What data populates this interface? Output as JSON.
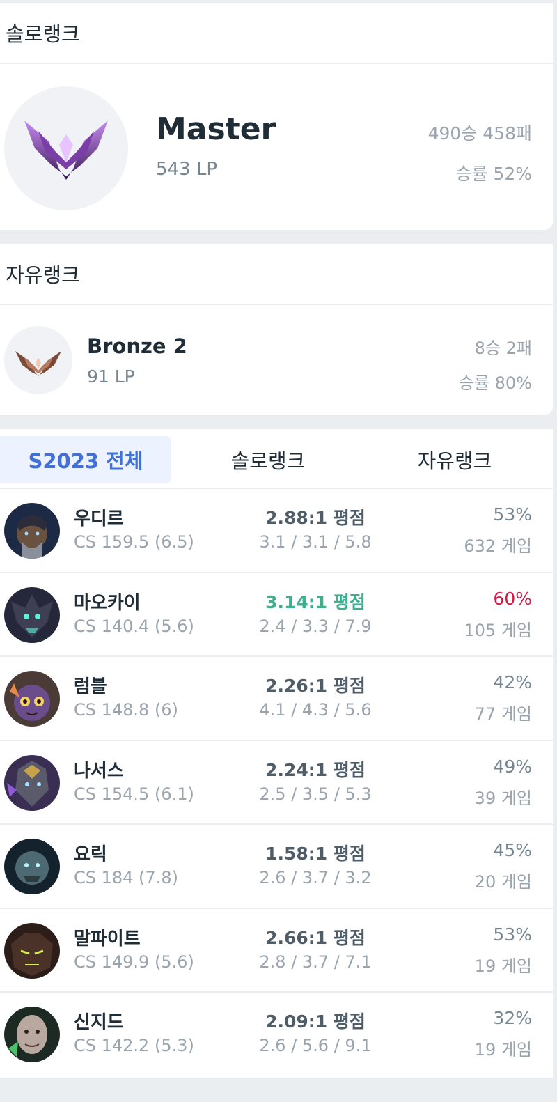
{
  "solo_rank": {
    "header": "솔로랭크",
    "tier": "Master",
    "lp": "543 LP",
    "record": "490승 458패",
    "winrate": "승률 52%"
  },
  "flex_rank": {
    "header": "자유랭크",
    "tier": "Bronze 2",
    "lp": "91 LP",
    "record": "8승 2패",
    "winrate": "승률 80%"
  },
  "tabs": [
    "S2023 전체",
    "솔로랭크",
    "자유랭크"
  ],
  "active_tab": "S2023 전체",
  "champions": [
    {
      "name": "우디르",
      "cs": "CS 159.5 (6.5)",
      "kda_ratio": "2.88:1 평점",
      "kda": "3.1 / 3.1 / 5.8",
      "winrate": "53%",
      "games": "632 게임"
    },
    {
      "name": "마오카이",
      "cs": "CS 140.4 (5.6)",
      "kda_ratio": "3.14:1 평점",
      "kda": "2.4 / 3.3 / 7.9",
      "winrate": "60%",
      "games": "105 게임"
    },
    {
      "name": "럼블",
      "cs": "CS 148.8 (6)",
      "kda_ratio": "2.26:1 평점",
      "kda": "4.1 / 4.3 / 5.6",
      "winrate": "42%",
      "games": "77 게임"
    },
    {
      "name": "나서스",
      "cs": "CS 154.5 (6.1)",
      "kda_ratio": "2.24:1 평점",
      "kda": "2.5 / 3.5 / 5.3",
      "winrate": "49%",
      "games": "39 게임"
    },
    {
      "name": "요릭",
      "cs": "CS 184 (7.8)",
      "kda_ratio": "1.58:1 평점",
      "kda": "2.6 / 3.7 / 3.2",
      "winrate": "45%",
      "games": "20 게임"
    },
    {
      "name": "말파이트",
      "cs": "CS 149.9 (5.6)",
      "kda_ratio": "2.66:1 평점",
      "kda": "2.8 / 3.7 / 7.1",
      "winrate": "53%",
      "games": "19 게임"
    },
    {
      "name": "신지드",
      "cs": "CS 142.2 (5.3)",
      "kda_ratio": "2.09:1 평점",
      "kda": "2.6 / 5.6 / 9.1",
      "winrate": "32%",
      "games": "19 게임"
    }
  ],
  "colors": {
    "accent_blue": "#4171d6",
    "kda_good": "#3eb08f",
    "winrate_high": "#d31a45"
  }
}
